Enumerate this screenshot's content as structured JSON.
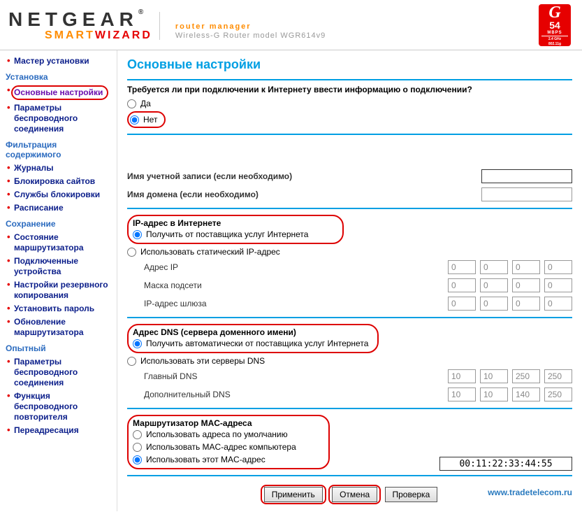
{
  "header": {
    "brand": "NETGEAR",
    "product": "SMARTWIZARD",
    "tagline1": "router manager",
    "tagline2": "Wireless-G Router model WGR614v9",
    "badge": {
      "g": "G",
      "speed": "54",
      "unit": "MBPS",
      "sub1": "2.4 GHz",
      "sub2": "802.11g"
    }
  },
  "sidebar": {
    "sections": [
      {
        "type": "item",
        "label": "Мастер установки"
      },
      {
        "type": "header",
        "label": "Установка"
      },
      {
        "type": "item",
        "label": "Основные настройки",
        "active": true,
        "circled": true
      },
      {
        "type": "item",
        "label": "Параметры беспроводного соединения"
      },
      {
        "type": "header",
        "label": "Фильтрация содержимого"
      },
      {
        "type": "item",
        "label": "Журналы"
      },
      {
        "type": "item",
        "label": "Блокировка сайтов"
      },
      {
        "type": "item",
        "label": "Службы блокировки"
      },
      {
        "type": "item",
        "label": "Расписание"
      },
      {
        "type": "header",
        "label": "Сохранение"
      },
      {
        "type": "item",
        "label": "Состояние маршрутизатора"
      },
      {
        "type": "item",
        "label": "Подключенные устройства"
      },
      {
        "type": "item",
        "label": "Настройки резервного копирования"
      },
      {
        "type": "item",
        "label": "Установить пароль"
      },
      {
        "type": "item",
        "label": "Обновление маршрутизатора"
      },
      {
        "type": "header",
        "label": "Опытный"
      },
      {
        "type": "item",
        "label": "Параметры беспроводного соединения"
      },
      {
        "type": "item",
        "label": "Функция беспроводного повторителя"
      },
      {
        "type": "item",
        "label": "Переадресация"
      }
    ]
  },
  "page": {
    "title": "Основные настройки",
    "login_q": "Требуется ли при подключении к Интернету ввести информацию о подключении?",
    "yes": "Да",
    "no": "Нет",
    "account_label": "Имя учетной записи  (если необходимо)",
    "domain_label": "Имя домена  (если необходимо)",
    "ip_section": "IP-адрес в Интернете",
    "ip_opt1": "Получить от поставщика услуг Интернета",
    "ip_opt2": "Использовать статический IP-адрес",
    "ip_addr": "Адрес IP",
    "subnet": "Маска подсети",
    "gateway": "IP-адрес шлюза",
    "ip_vals": {
      "addr": [
        "0",
        "0",
        "0",
        "0"
      ],
      "mask": [
        "0",
        "0",
        "0",
        "0"
      ],
      "gw": [
        "0",
        "0",
        "0",
        "0"
      ]
    },
    "dns_section": "Адрес DNS (сервера доменного имени)",
    "dns_opt1": "Получить автоматически от поставщика услуг Интернета",
    "dns_opt2": "Использовать эти серверы DNS",
    "dns_primary": "Главный DNS",
    "dns_secondary": "Дополнительный DNS",
    "dns_vals": {
      "p": [
        "10",
        "10",
        "250",
        "250"
      ],
      "s": [
        "10",
        "10",
        "140",
        "250"
      ]
    },
    "mac_section": "Маршрутизатор MAC-адреса",
    "mac_opt1": "Использовать адреса по умолчанию",
    "mac_opt2": "Использовать MAC-адрес компьютера",
    "mac_opt3": "Использовать этот MAC-адрес",
    "mac_value": "00:11:22:33:44:55",
    "btn_apply": "Применить",
    "btn_cancel": "Отмена",
    "btn_test": "Проверка",
    "footer_link": "www.tradetelecom.ru"
  }
}
